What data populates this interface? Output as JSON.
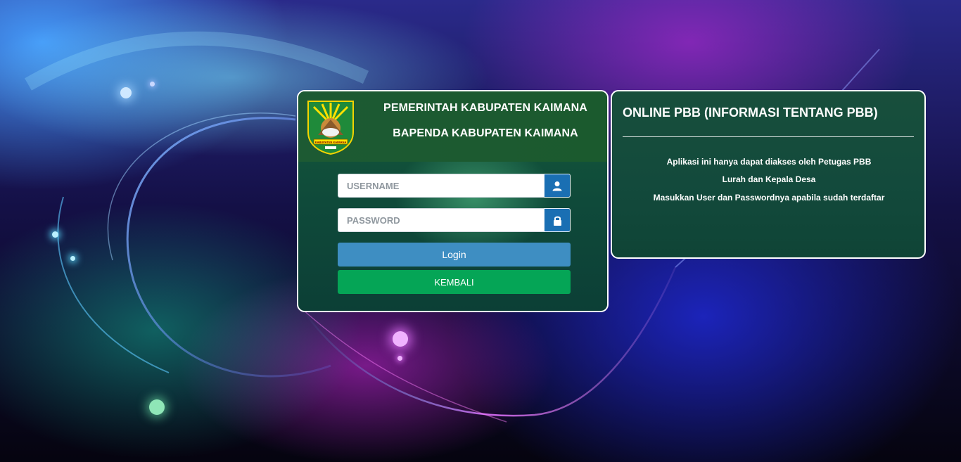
{
  "colors": {
    "panel_green": "#155a3a",
    "header_green": "#1d5a33",
    "addon_blue": "#1a6fb3",
    "login_button": "#3e8ec2",
    "back_button": "#05a556",
    "panel_border": "#ffffff"
  },
  "login_panel": {
    "logo_icon": "kaimana-regency-crest-icon",
    "logo_banner_text": "KABUPATEN KAIMANA",
    "header_line_1": "PEMERINTAH KABUPATEN KAIMANA",
    "header_line_2": "BAPENDA KABUPATEN KAIMANA",
    "username": {
      "placeholder": "USERNAME",
      "value": "",
      "icon": "user-icon"
    },
    "password": {
      "placeholder": "PASSWORD",
      "value": "",
      "icon": "lock-icon"
    },
    "login_label": "Login",
    "back_label": "KEMBALI"
  },
  "info_panel": {
    "title": "ONLINE PBB (INFORMASI TENTANG PBB)",
    "lines": [
      "Aplikasi ini hanya dapat diakses oleh Petugas PBB",
      "Lurah dan Kepala Desa",
      "Masukkan User dan Passwordnya apabila sudah terdaftar"
    ]
  }
}
